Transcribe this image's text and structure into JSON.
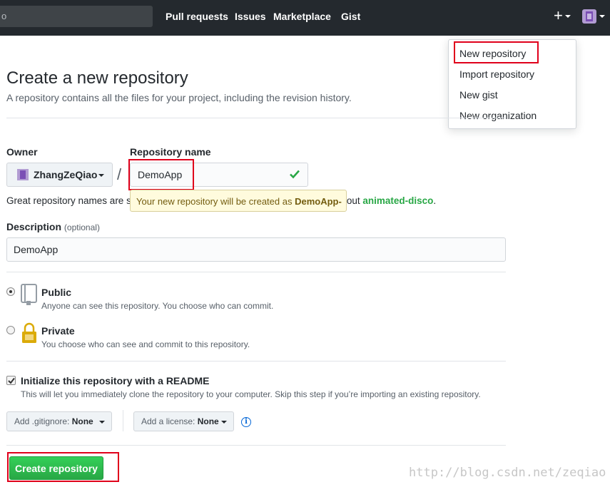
{
  "header": {
    "search_placeholder": "o",
    "nav": [
      "Pull requests",
      "Issues",
      "Marketplace",
      "Gist"
    ],
    "plus_glyph": "+"
  },
  "dropdown": {
    "items": [
      "New repository",
      "Import repository",
      "New gist",
      "New organization"
    ]
  },
  "page": {
    "title": "Create a new repository",
    "subtitle": "A repository contains all the files for your project, including the revision history."
  },
  "form": {
    "owner_label": "Owner",
    "owner_value": "ZhangZeQiao",
    "slash": "/",
    "repo_label": "Repository name",
    "repo_value": "DemoApp",
    "hint_prefix": "Great repository names are s",
    "hint_suffix": "out ",
    "hint_suggestion": "animated-disco",
    "hint_period": ".",
    "tooltip_prefix": "Your new repository will be created as ",
    "tooltip_name": "DemoApp-",
    "description_label": "Description",
    "description_optional": "(optional)",
    "description_value": "DemoApp",
    "public_title": "Public",
    "public_desc": "Anyone can see this repository. You choose who can commit.",
    "private_title": "Private",
    "private_desc": "You choose who can see and commit to this repository.",
    "init_title": "Initialize this repository with a README",
    "init_desc": "This will let you immediately clone the repository to your computer. Skip this step if you’re importing an existing repository.",
    "gitignore_label": "Add .gitignore:",
    "gitignore_value": "None",
    "license_label": "Add a license:",
    "license_value": "None",
    "info_glyph": "i",
    "create_label": "Create repository"
  },
  "watermark": "http://blog.csdn.net/zeqiao",
  "colors": {
    "header_bg": "#24292e",
    "highlight_box": "#e0001b",
    "primary_button": "#28a745",
    "link_blue": "#0366d6"
  }
}
